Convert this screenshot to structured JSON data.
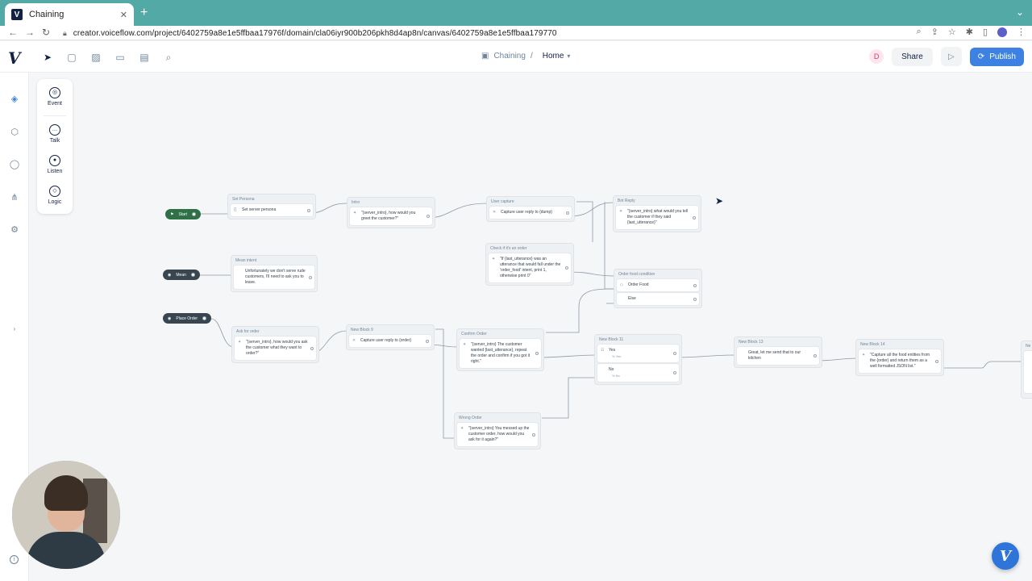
{
  "browser": {
    "tab_title": "Chaining",
    "favicon_letter": "V",
    "tab_close": "✕",
    "new_tab": "+",
    "url": "creator.voiceflow.com/project/6402759a8e1e5ffbaa17976f/domain/cla06iyr900b206pkh8d4ap8n/canvas/6402759a8e1e5ffbaa179770"
  },
  "header": {
    "logo": "V",
    "project_name": "Chaining",
    "separator": "/",
    "current_page": "Home",
    "avatar_initial": "D",
    "share_label": "Share",
    "publish_label": "Publish"
  },
  "palette": {
    "items": [
      {
        "label": "Event"
      },
      {
        "label": "Talk"
      },
      {
        "label": "Listen"
      },
      {
        "label": "Logic"
      }
    ]
  },
  "canvas": {
    "starts": [
      {
        "label": "Start"
      },
      {
        "label": "Mean"
      },
      {
        "label": "Place Order"
      }
    ],
    "blocks": [
      {
        "title": "Set Persona",
        "steps": [
          {
            "text": "Set server persona"
          }
        ]
      },
      {
        "title": "Intro",
        "steps": [
          {
            "text": "\"{server_intro}, how would you greet the customer?\""
          }
        ]
      },
      {
        "title": "User capture",
        "steps": [
          {
            "text": "Capture user reply to {dump}"
          }
        ]
      },
      {
        "title": "Bot Reply",
        "steps": [
          {
            "text": "\"{server_intro} what would you tell the customer if they said {last_utterance}\""
          }
        ]
      },
      {
        "title": "Check if it's an order",
        "steps": [
          {
            "text": "\"If {last_utterance} was an utterance that would fall under the 'order_food' intent, print 1, otherwise print 0\""
          }
        ]
      },
      {
        "title": "Order food condition",
        "steps": [
          {
            "text": "Order Food"
          },
          {
            "text": "Else"
          }
        ]
      },
      {
        "title": "Mean intent",
        "steps": [
          {
            "text": "Unfortunately we don't serve rude customers, I'll need to ask you to leave."
          }
        ]
      },
      {
        "title": "Ask for order",
        "steps": [
          {
            "text": "\"{server_intro}, how would you ask the customer what they want to order?\""
          }
        ]
      },
      {
        "title": "New Block 9",
        "steps": [
          {
            "text": "Capture user reply to {order}"
          }
        ]
      },
      {
        "title": "Confirm Order",
        "steps": [
          {
            "text": "\"{server_intro} The customer wanted {last_utterance}, repeat the order and confirm if you got it right.\""
          }
        ]
      },
      {
        "title": "New Block 11",
        "steps": [
          {
            "text": "Yes",
            "sub": "% Yes"
          },
          {
            "text": "No",
            "sub": "% No"
          }
        ]
      },
      {
        "title": "New Block 13",
        "steps": [
          {
            "text": "Great, let me send that to our kitchen"
          }
        ]
      },
      {
        "title": "New Block 14",
        "steps": [
          {
            "text": "\"Capture all the food entities from the {order} and return them as a well formatted JSON list.\""
          }
        ]
      },
      {
        "title": "Wrong Order",
        "steps": [
          {
            "text": "\"{server_intro} You messed up the customer order, how would you ask for it again?\""
          }
        ]
      },
      {
        "title": "Ne",
        "steps": [
          {
            "text": ""
          }
        ]
      }
    ]
  },
  "colors": {
    "browser_tabbar": "#53a9a6",
    "publish": "#3d82e2",
    "start_pill": "#2f7046",
    "intent_pill": "#3a464f"
  }
}
